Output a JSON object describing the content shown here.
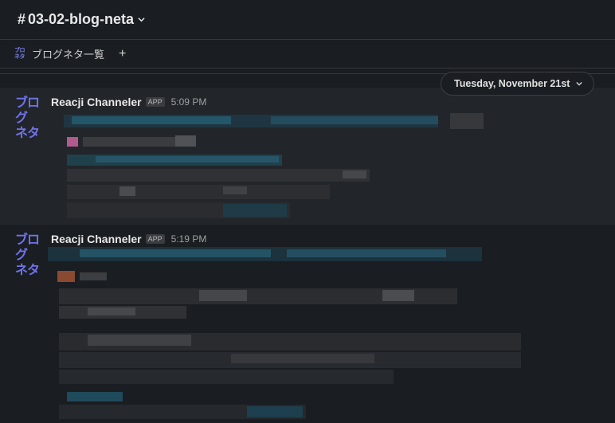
{
  "header": {
    "channel_name": "03-02-blog-neta",
    "hash": "#"
  },
  "bookmarks": {
    "items": [
      {
        "label": "ブログネタ一覧",
        "icon_lines": [
          "ブロ",
          "ネタ"
        ]
      }
    ],
    "add_label": "+"
  },
  "date_divider": {
    "label": "Tuesday, November 21st"
  },
  "messages": [
    {
      "sender": "Reacji Channeler",
      "badge": "APP",
      "time": "5:09 PM",
      "avatar_lines": [
        "ブログ",
        "ネタ"
      ]
    },
    {
      "sender": "Reacji Channeler",
      "badge": "APP",
      "time": "5:19 PM",
      "avatar_lines": [
        "ブログ",
        "ネタ"
      ]
    }
  ],
  "colors": {
    "background": "#1a1d21",
    "hover_row": "#222529",
    "avatar_text": "#6f73ea",
    "blur_link": "#1f4a5c"
  }
}
